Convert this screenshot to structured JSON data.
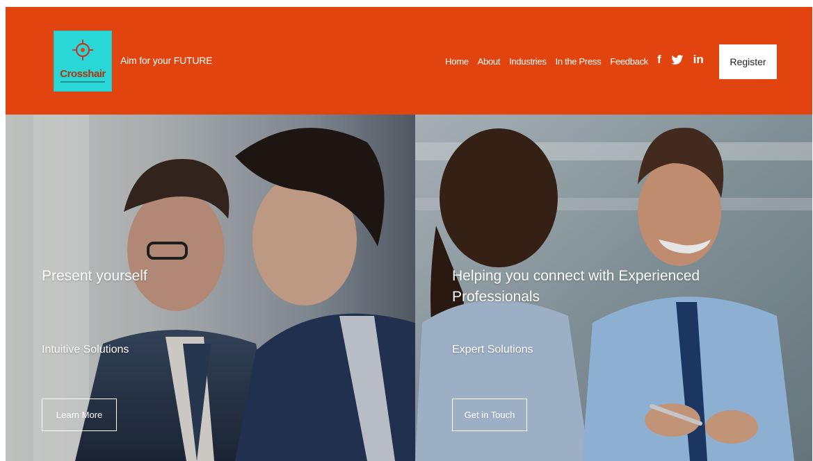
{
  "header": {
    "logo_text": "Crosshair",
    "tagline": "Aim for your FUTURE",
    "nav": [
      "Home",
      "About",
      "Industries",
      "In the Press",
      "Feedback"
    ],
    "social_icons": [
      "facebook-icon",
      "twitter-icon",
      "linkedin-icon"
    ],
    "register_label": "Register",
    "brand_color": "#e2440f",
    "logo_color": "#2ad7d7"
  },
  "hero": {
    "left": {
      "title": "Present yourself",
      "subtitle": "Intuitive Solutions",
      "button": "Learn More"
    },
    "right": {
      "title": "Helping you connect with Experienced Professionals",
      "subtitle": "Expert Solutions",
      "button": "Get in Touch"
    }
  }
}
